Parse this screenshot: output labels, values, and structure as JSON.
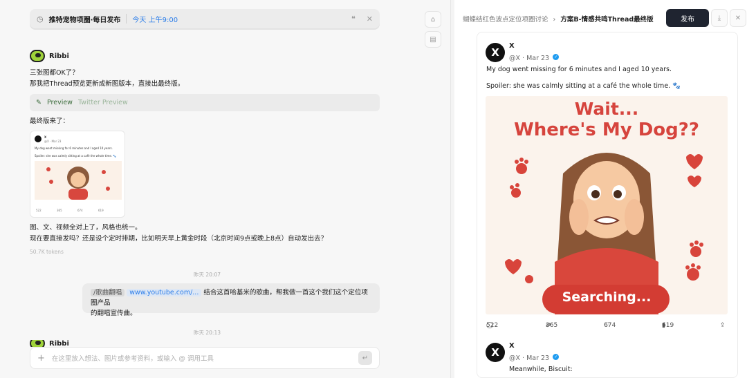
{
  "banner": {
    "title": "推特宠物项圈·每日发布",
    "schedule": "今天 上午9:00"
  },
  "chat": {
    "sender1": "Ribbi",
    "msg1": [
      "三张图都OK了？",
      "那我把Thread预览更新成新图版本，直接出最终版。"
    ],
    "preview_label": "Preview",
    "preview_sub": "Twitter Preview",
    "final_label": "最终版来了：",
    "msg2": [
      "图、文、视频全对上了，风格也统一。",
      "现在要直接发吗？还是设个定时排期，比如明天早上黄金时段（北京时间9点或晚上8点）自动发出去？"
    ],
    "tokens": "50.7K tokens",
    "time1": "昨天 20:07",
    "user_tag": "/歌曲翻唱",
    "user_link": "www.youtube.com/...",
    "user_text_1": "结合这首哈基米的歌曲，帮我做一首这个我们这个定位项圈产品",
    "user_text_2": "的翻唱宣传曲。",
    "time2": "昨天 20:13",
    "sender2": "Ribbi"
  },
  "thumb": {
    "name": "X",
    "meta": "@X · Mar 23",
    "line1": "My dog went missing for 6 minutes and I aged 10 years.",
    "line2": "Spoiler: she was calmly sitting at a café the whole time. 🐾",
    "stats": [
      "522",
      "365",
      "674",
      "619"
    ]
  },
  "input": {
    "placeholder": "在这里放入想法、图片或参考资料，或输入 @ 调用工具"
  },
  "right": {
    "crumb_parent": "蝴蝶结红色波点定位项圈讨论",
    "crumb_sep": "›",
    "crumb_current": "方案B-情感共鸣Thread最终版",
    "publish": "发布",
    "post1": {
      "name": "X",
      "handle": "@X · Mar 23",
      "text1": "My dog went missing for 6 minutes and I aged 10 years.",
      "text2": "Spoiler: she was calmly sitting at a café the whole time. 🐾",
      "image_line1": "Wait...",
      "image_line2": "Where's My Dog??",
      "image_button": "Searching...",
      "replies": "522",
      "reposts": "365",
      "likes": "674",
      "views": "619"
    },
    "post2": {
      "name": "X",
      "handle": "@X · Mar 23",
      "text": "Meanwhile, Biscuit:"
    }
  },
  "colors": {
    "accent": "#2b7de9",
    "publish_bg": "#1f2430",
    "title_red": "#d6443d",
    "verified": "#1d9bf0"
  }
}
